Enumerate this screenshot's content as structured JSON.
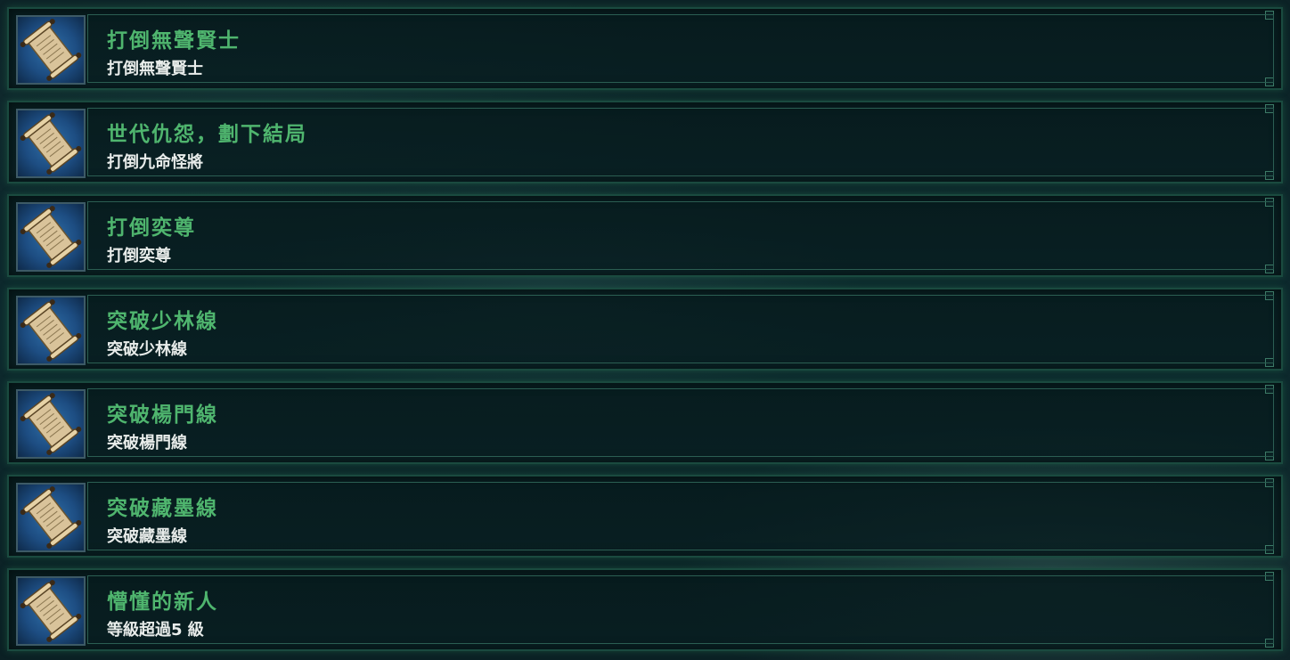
{
  "achievements": [
    {
      "title": "打倒無聲賢士",
      "description": "打倒無聲賢士",
      "icon": "scroll-icon"
    },
    {
      "title": "世代仇怨，劃下結局",
      "description": "打倒九命怪將",
      "icon": "scroll-icon"
    },
    {
      "title": "打倒奕尊",
      "description": "打倒奕尊",
      "icon": "scroll-icon"
    },
    {
      "title": "突破少林線",
      "description": "突破少林線",
      "icon": "scroll-icon"
    },
    {
      "title": "突破楊門線",
      "description": "突破楊門線",
      "icon": "scroll-icon"
    },
    {
      "title": "突破藏墨線",
      "description": "突破藏墨線",
      "icon": "scroll-icon"
    },
    {
      "title": "懵懂的新人",
      "description": "等級超過5 級",
      "icon": "scroll-icon"
    }
  ],
  "colors": {
    "title": "#4fb56e",
    "description": "#e8ecea",
    "frame": "#1a4a3f",
    "icon_bg": "#1d4d82"
  }
}
